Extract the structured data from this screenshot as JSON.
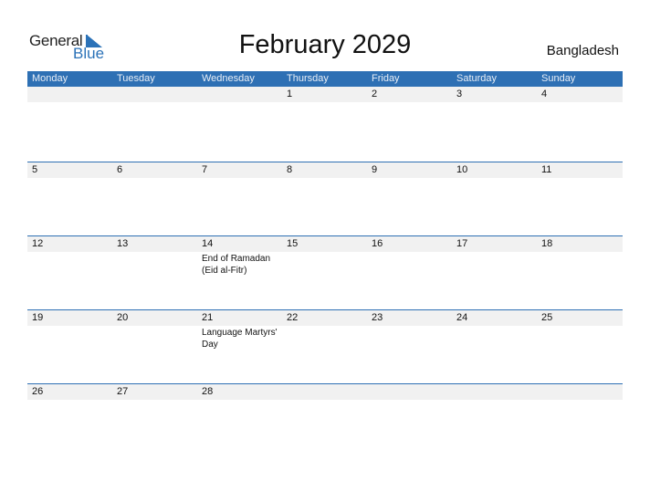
{
  "logo": {
    "general": "General",
    "blue": "Blue"
  },
  "title": "February 2029",
  "country": "Bangladesh",
  "weekdays": [
    "Monday",
    "Tuesday",
    "Wednesday",
    "Thursday",
    "Friday",
    "Saturday",
    "Sunday"
  ],
  "weeks": [
    {
      "days": [
        "",
        "",
        "",
        "1",
        "2",
        "3",
        "4"
      ],
      "events": [
        "",
        "",
        "",
        "",
        "",
        "",
        ""
      ]
    },
    {
      "days": [
        "5",
        "6",
        "7",
        "8",
        "9",
        "10",
        "11"
      ],
      "events": [
        "",
        "",
        "",
        "",
        "",
        "",
        ""
      ]
    },
    {
      "days": [
        "12",
        "13",
        "14",
        "15",
        "16",
        "17",
        "18"
      ],
      "events": [
        "",
        "",
        "End of Ramadan (Eid al-Fitr)",
        "",
        "",
        "",
        ""
      ]
    },
    {
      "days": [
        "19",
        "20",
        "21",
        "22",
        "23",
        "24",
        "25"
      ],
      "events": [
        "",
        "",
        "Language Martyrs' Day",
        "",
        "",
        "",
        ""
      ]
    },
    {
      "days": [
        "26",
        "27",
        "28",
        "",
        "",
        "",
        ""
      ],
      "events": [
        "",
        "",
        "",
        "",
        "",
        "",
        ""
      ]
    }
  ],
  "colors": {
    "accent": "#2e70b4",
    "strip": "#f1f1f1"
  }
}
